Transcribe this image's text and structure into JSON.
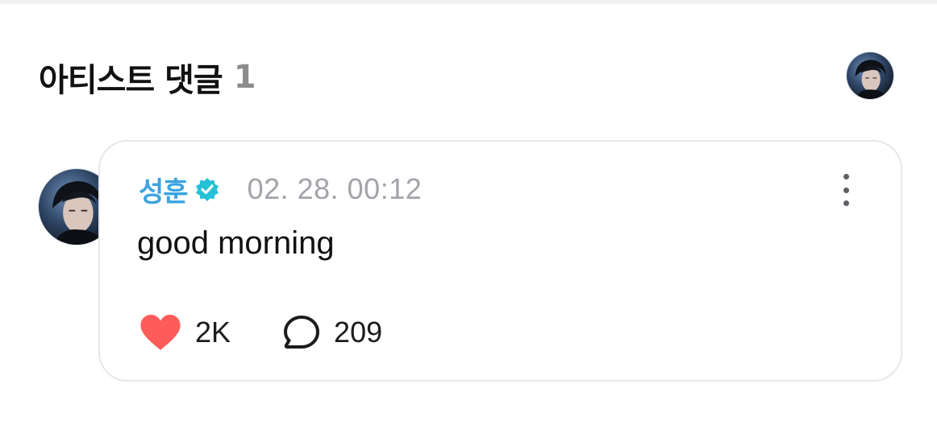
{
  "header": {
    "title": "아티스트 댓글",
    "count": "1"
  },
  "comment": {
    "author": "성훈",
    "verified": true,
    "timestamp": "02. 28. 00:12",
    "text": "good morning",
    "likes": "2K",
    "replies": "209"
  },
  "icons": {
    "verified": "verified-badge-icon",
    "more": "more-vertical-icon",
    "like": "heart-icon",
    "reply": "speech-bubble-icon"
  },
  "colors": {
    "author": "#3aa3e0",
    "verified_badge": "#25c1d6",
    "heart": "#ff5b5b",
    "timestamp": "#a3a3a9",
    "card_border": "#e7e7ec"
  }
}
